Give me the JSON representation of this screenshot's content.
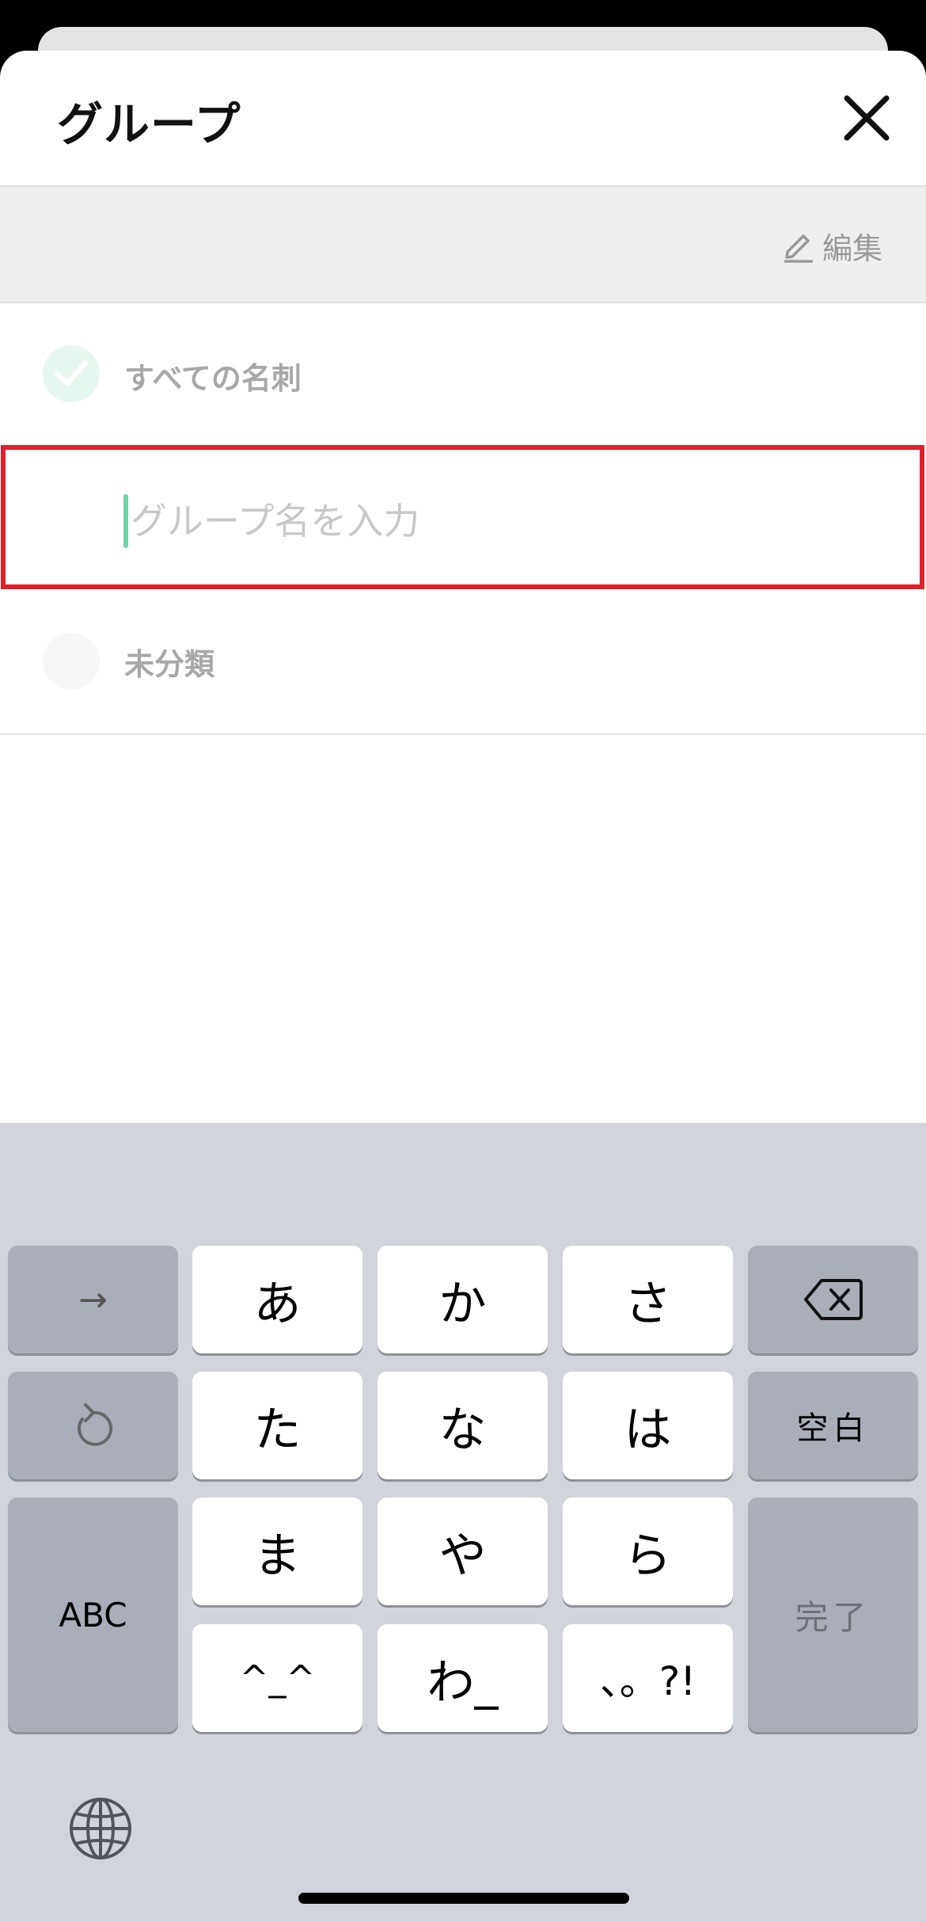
{
  "header": {
    "title": "グループ",
    "close_icon": "close-icon"
  },
  "edit_bar": {
    "edit_label": "編集",
    "edit_icon": "pencil-icon"
  },
  "groups": {
    "all_cards_label": "すべての名刺",
    "all_cards_selected": true,
    "new_group_placeholder": "グループ名を入力",
    "new_group_value": "",
    "uncategorized_label": "未分類"
  },
  "keyboard": {
    "row1": {
      "left": "→",
      "keys": [
        "あ",
        "か",
        "さ"
      ],
      "right_icon": "backspace-icon"
    },
    "row2": {
      "left_icon": "undo-icon",
      "keys": [
        "た",
        "な",
        "は"
      ],
      "right": "空白"
    },
    "row3": {
      "left": "ABC",
      "keys": [
        "ま",
        "や",
        "ら"
      ],
      "right": "完了"
    },
    "row4": {
      "keys": [
        "^_^",
        "わ_",
        "、。?!"
      ]
    },
    "globe_icon": "globe-icon"
  },
  "colors": {
    "accent_green": "#74d3a6",
    "highlight_red": "#e0202c",
    "keyboard_bg": "#d1d4db"
  }
}
